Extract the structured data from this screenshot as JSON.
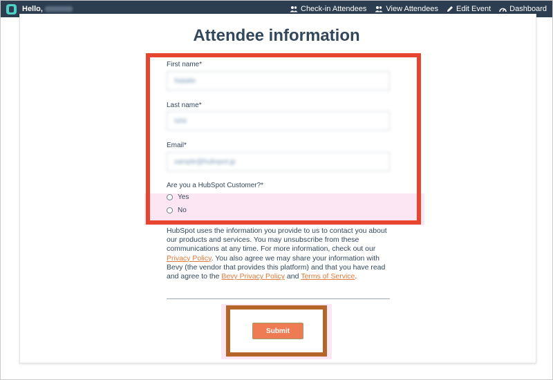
{
  "topbar": {
    "greeting": "Hello,",
    "nav": [
      {
        "label": "Check-in Attendees",
        "icon": "people-icon"
      },
      {
        "label": "View Attendees",
        "icon": "people-icon"
      },
      {
        "label": "Edit Event",
        "icon": "pencil-icon"
      },
      {
        "label": "Dashboard",
        "icon": "gauge-icon"
      }
    ]
  },
  "form": {
    "title": "Attendee information",
    "first_name": {
      "label": "First name*",
      "value": "Natalie"
    },
    "last_name": {
      "label": "Last name*",
      "value": "Ishii"
    },
    "email": {
      "label": "Email*",
      "value": "sample@hubspot.jp"
    },
    "customer_question": "Are you a HubSpot Customer?*",
    "options": [
      "Yes",
      "No"
    ],
    "legal": {
      "line1": "HubSpot uses the information you provide to us to contact you about our products and services. You may unsubscribe from these communications at any time. For more information, check out our ",
      "privacy_link": "Privacy Policy",
      "line2": ". You also agree we may share your information with Bevy (the vendor that provides this platform) and that you have read and agree to the ",
      "bevy_link": "Bevy Privacy Policy",
      "line3": " and ",
      "terms_link": "Terms of Service",
      "line4": "."
    },
    "submit_label": "Submit"
  },
  "colors": {
    "topbar": "#2d3e50",
    "accent": "#ef7b55",
    "highlight_red": "#e8452e",
    "highlight_brown": "#b5652a",
    "link": "#e07a3a"
  }
}
